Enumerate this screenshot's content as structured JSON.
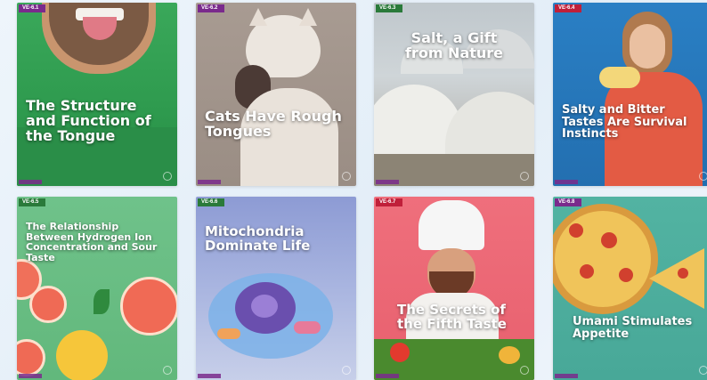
{
  "cards": [
    {
      "tag": "VE-6.1",
      "title": "The Structure and Function of the Tongue",
      "tag_color": "#7a2a8c"
    },
    {
      "tag": "VE-6.2",
      "title": "Cats Have Rough Tongues",
      "tag_color": "#7a2a8c"
    },
    {
      "tag": "VE-6.3",
      "title": "Salt, a Gift from Nature",
      "tag_color": "#2a7a3a"
    },
    {
      "tag": "VE-6.4",
      "title": "Salty and Bitter Tastes Are Survival Instincts",
      "tag_color": "#c0203a"
    },
    {
      "tag": "VE-6.5",
      "title": "The Relationship Between Hydrogen Ion Concentration and Sour Taste",
      "tag_color": "#2a7a3a"
    },
    {
      "tag": "VE-6.6",
      "title": "Mitochondria Dominate Life",
      "tag_color": "#2a7a3a"
    },
    {
      "tag": "VE-6.7",
      "title": "The Secrets of the Fifth Taste",
      "tag_color": "#c0203a"
    },
    {
      "tag": "VE-6.8",
      "title": "Umami Stimulates Appetite",
      "tag_color": "#7a2a8c"
    }
  ]
}
